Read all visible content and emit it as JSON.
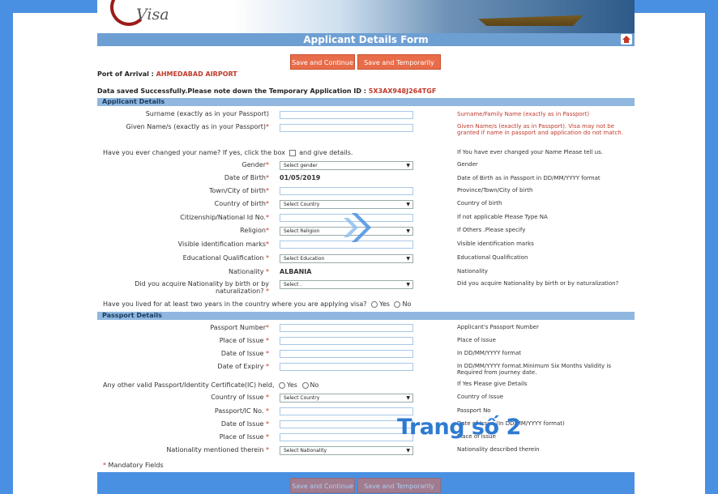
{
  "banner": {
    "logo_text": "Visa"
  },
  "form": {
    "title": "Applicant Details Form",
    "save_continue_label": "Save and Continue",
    "save_exit_label": "Save and Temporarily Exit",
    "port_label": "Port of Arrival :",
    "port_value": "AHMEDABAD AIRPORT",
    "saved_message": "Data saved Successfully.Please note down the Temporary Application ID :",
    "application_id": "5X3AX948J264TGF"
  },
  "applicant": {
    "section_title": "Applicant Details",
    "surname_label": "Surname (exactly as in your Passport)",
    "surname_help": "Surname/Family Name (exactly as in Passport)",
    "given_label": "Given Name/s (exactly as in your Passport)",
    "given_help": "Given Name/s (exactly as in Passport). Visa may not be granted if name in passport and application do not match.",
    "changed_name_text": "Have you ever changed your name? If yes, click the box",
    "changed_name_suffix": "and give details.",
    "changed_name_help": "If You have ever changed your Name Please tell us.",
    "gender_label": "Gender",
    "gender_value": "Select gender",
    "gender_help": "Gender",
    "dob_label": "Date of Birth",
    "dob_value": "01/05/2019",
    "dob_help": "Date of Birth as in Passport in DD/MM/YYYY format",
    "town_label": "Town/City of birth",
    "town_help": "Province/Town/City of birth",
    "country_label": "Country of birth",
    "country_value": "Select Country",
    "country_help": "Country of birth",
    "citizenship_label": "Citizenship/National Id No.",
    "citizenship_help": "If not applicable Please Type NA",
    "religion_label": "Religion",
    "religion_value": "Select Religion",
    "religion_help": "If Others .Please specify",
    "marks_label": "Visible identification marks",
    "marks_help": "Visible identification marks",
    "education_label": "Educational Qualification",
    "education_value": "Select Education",
    "education_help": "Educational Qualification",
    "nationality_label": "Nationality",
    "nationality_value": "ALBANIA",
    "nationality_help": "Nationality",
    "acquire_label": "Did you acquire Nationality by birth or by naturalization?",
    "acquire_value": "Select .",
    "acquire_help": "Did you acquire Nationality by birth or by naturalization?",
    "lived_text": "Have you lived for at least two years in the country where you are applying visa?",
    "yes": "Yes",
    "no": "No"
  },
  "passport": {
    "section_title": "Passport Details",
    "number_label": "Passport Number",
    "number_help": "Applicant's Passport Number",
    "place_label": "Place of Issue",
    "place_help": "Place of Issue",
    "issue_label": "Date of Issue",
    "issue_help": "In DD/MM/YYYY format",
    "expiry_label": "Date of Expiry",
    "expiry_help": "In DD/MM/YYYY format.Minimum Six Months Validity is Required from journey date.",
    "other_text": "Any other valid Passport/Identity Certificate(IC) held,",
    "other_help": "If Yes Please give Details",
    "ic_country_label": "Country of Issue",
    "ic_country_value": "Select Country",
    "ic_country_help": "Country of Issue",
    "ic_no_label": "Passport/IC No.",
    "ic_no_help": "Passport No",
    "ic_date_label": "Date of Issue",
    "ic_date_help": "Date of Issue (In DD/MM/YYYY format)",
    "ic_place_label": "Place of Issue",
    "ic_place_help": "Place of Issue",
    "ic_nat_label": "Nationality mentioned therein",
    "ic_nat_value": "Select Nationality",
    "ic_nat_help": "Nationality described therein"
  },
  "footer": {
    "mandatory": "Mandatory Fields"
  },
  "overlay": {
    "page_label": "Trang số 2"
  },
  "colors": {
    "accent": "#e86c4a",
    "section": "#8fb7df",
    "title_bar": "#6d9fd3",
    "background": "#4a90e2"
  }
}
